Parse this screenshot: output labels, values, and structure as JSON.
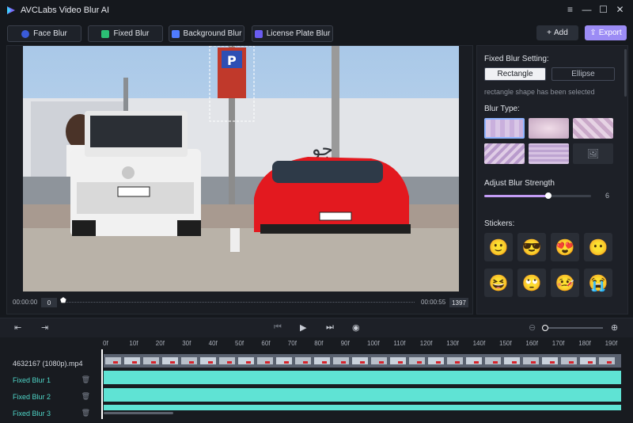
{
  "app": {
    "title": "AVCLabs Video Blur AI"
  },
  "window_controls": [
    "≡",
    "—",
    "☐",
    "✕"
  ],
  "modes": [
    {
      "label": "Face Blur",
      "icon": "face-blur-icon",
      "color": "#3a5bd9"
    },
    {
      "label": "Fixed Blur",
      "icon": "fixed-blur-icon",
      "color": "#2bbf74"
    },
    {
      "label": "Background Blur",
      "icon": "background-blur-icon",
      "color": "#4f7bff"
    },
    {
      "label": "License Plate Blur",
      "icon": "license-plate-icon",
      "color": "#6a5cf0"
    }
  ],
  "toolbar": {
    "add_label": "Add",
    "export_label": "Export"
  },
  "player": {
    "time_start": "00:00:00",
    "frame_current": "0",
    "time_end": "00:00:55",
    "frame_total": "1397"
  },
  "sidebar": {
    "fixed_blur_setting_label": "Fixed Blur Setting:",
    "shape_rectangle": "Rectangle",
    "shape_ellipse": "Ellipse",
    "shape_status": "rectangle shape has been selected",
    "blur_type_label": "Blur Type:",
    "adjust_strength_label": "Adjust Blur Strength",
    "strength_value": "6",
    "strength_fraction": 0.6,
    "stickers_label": "Stickers:",
    "stickers": [
      "🙂",
      "😎",
      "😍",
      "😶",
      "😆",
      "🙄",
      "🤒",
      "😭"
    ]
  },
  "timeline": {
    "ticks": [
      "0f",
      "10f",
      "20f",
      "30f",
      "40f",
      "50f",
      "60f",
      "70f",
      "80f",
      "90f",
      "100f",
      "110f",
      "120f",
      "130f",
      "140f",
      "150f",
      "160f",
      "170f",
      "180f",
      "190f"
    ],
    "tracks": {
      "video": "4632167 (1080p).mp4",
      "blur1": "Fixed Blur 1",
      "blur2": "Fixed Blur 2",
      "blur3": "Fixed Blur 3"
    }
  },
  "colors": {
    "accent": "#9c8cf5",
    "track": "#5fe3d4",
    "bg": "#15181d"
  }
}
